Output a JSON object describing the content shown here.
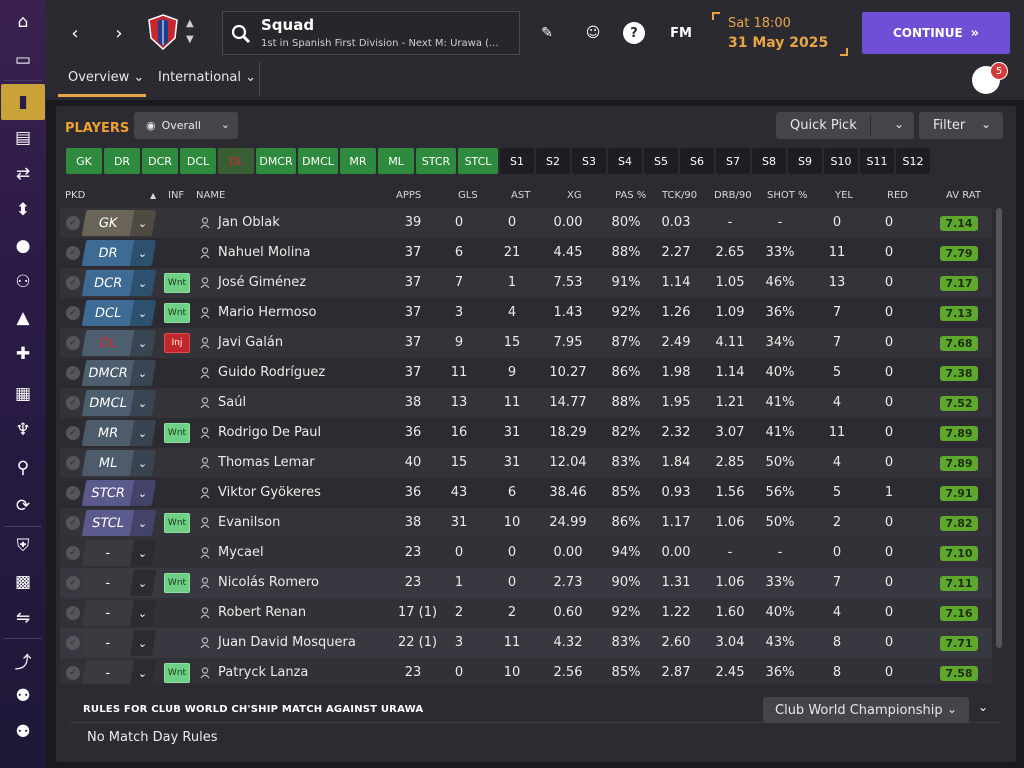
{
  "header": {
    "title": "Squad",
    "subtitle": "1st in Spanish First Division - Next M: Urawa (...",
    "date_time": "Sat 18:00",
    "date_day": "31 May 2025",
    "continue_label": "CONTINUE",
    "tabs": [
      {
        "label": "Overview",
        "active": true
      },
      {
        "label": "International",
        "active": false
      }
    ],
    "notification_count": "5",
    "fm_label": "FM",
    "help_label": "?"
  },
  "toolbar": {
    "players_label": "PLAYERS",
    "view_label": "Overall",
    "quick_pick_label": "Quick Pick",
    "filter_label": "Filter"
  },
  "position_filters": [
    "GK",
    "DR",
    "DCR",
    "DCL",
    "DL",
    "DMCR",
    "DMCL",
    "MR",
    "ML",
    "STCR",
    "STCL",
    "S1",
    "S2",
    "S3",
    "S4",
    "S5",
    "S6",
    "S7",
    "S8",
    "S9",
    "S10",
    "S11",
    "S12"
  ],
  "columns": [
    "PKD",
    "INF",
    "NAME",
    "APPS",
    "GLS",
    "AST",
    "XG",
    "PAS %",
    "TCK/90",
    "DRB/90",
    "SHOT %",
    "YEL",
    "RED",
    "AV RAT"
  ],
  "players": [
    {
      "pos": "GK",
      "inf": "",
      "name": "Jan Oblak",
      "apps": "39",
      "gls": "0",
      "ast": "0",
      "xg": "0.00",
      "pas": "80%",
      "tck": "0.03",
      "drb": "-",
      "shot": "-",
      "yel": "0",
      "red": "0",
      "rat": "7.14"
    },
    {
      "pos": "DR",
      "inf": "",
      "name": "Nahuel Molina",
      "apps": "37",
      "gls": "6",
      "ast": "21",
      "xg": "4.45",
      "pas": "88%",
      "tck": "2.27",
      "drb": "2.65",
      "shot": "33%",
      "yel": "11",
      "red": "0",
      "rat": "7.79"
    },
    {
      "pos": "DCR",
      "inf": "Wnt",
      "name": "José Giménez",
      "apps": "37",
      "gls": "7",
      "ast": "1",
      "xg": "7.53",
      "pas": "91%",
      "tck": "1.14",
      "drb": "1.05",
      "shot": "46%",
      "yel": "13",
      "red": "0",
      "rat": "7.17"
    },
    {
      "pos": "DCL",
      "inf": "Wnt",
      "name": "Mario Hermoso",
      "apps": "37",
      "gls": "3",
      "ast": "4",
      "xg": "1.43",
      "pas": "92%",
      "tck": "1.26",
      "drb": "1.09",
      "shot": "36%",
      "yel": "7",
      "red": "0",
      "rat": "7.13"
    },
    {
      "pos": "DL",
      "inf": "Inj",
      "name": "Javi Galán",
      "apps": "37",
      "gls": "9",
      "ast": "15",
      "xg": "7.95",
      "pas": "87%",
      "tck": "2.49",
      "drb": "4.11",
      "shot": "34%",
      "yel": "7",
      "red": "0",
      "rat": "7.68"
    },
    {
      "pos": "DMCR",
      "inf": "",
      "name": "Guido Rodríguez",
      "apps": "37",
      "gls": "11",
      "ast": "9",
      "xg": "10.27",
      "pas": "86%",
      "tck": "1.98",
      "drb": "1.14",
      "shot": "40%",
      "yel": "5",
      "red": "0",
      "rat": "7.38"
    },
    {
      "pos": "DMCL",
      "inf": "",
      "name": "Saúl",
      "apps": "38",
      "gls": "13",
      "ast": "11",
      "xg": "14.77",
      "pas": "88%",
      "tck": "1.95",
      "drb": "1.21",
      "shot": "41%",
      "yel": "4",
      "red": "0",
      "rat": "7.52"
    },
    {
      "pos": "MR",
      "inf": "Wnt",
      "name": "Rodrigo De Paul",
      "apps": "36",
      "gls": "16",
      "ast": "31",
      "xg": "18.29",
      "pas": "82%",
      "tck": "2.32",
      "drb": "3.07",
      "shot": "41%",
      "yel": "11",
      "red": "0",
      "rat": "7.89"
    },
    {
      "pos": "ML",
      "inf": "",
      "name": "Thomas Lemar",
      "apps": "40",
      "gls": "15",
      "ast": "31",
      "xg": "12.04",
      "pas": "83%",
      "tck": "1.84",
      "drb": "2.85",
      "shot": "50%",
      "yel": "4",
      "red": "0",
      "rat": "7.89"
    },
    {
      "pos": "STCR",
      "inf": "",
      "name": "Viktor Gyökeres",
      "apps": "36",
      "gls": "43",
      "ast": "6",
      "xg": "38.46",
      "pas": "85%",
      "tck": "0.93",
      "drb": "1.56",
      "shot": "56%",
      "yel": "5",
      "red": "1",
      "rat": "7.91"
    },
    {
      "pos": "STCL",
      "inf": "Wnt",
      "name": "Evanilson",
      "apps": "38",
      "gls": "31",
      "ast": "10",
      "xg": "24.99",
      "pas": "86%",
      "tck": "1.17",
      "drb": "1.06",
      "shot": "50%",
      "yel": "2",
      "red": "0",
      "rat": "7.82"
    },
    {
      "pos": "-",
      "inf": "",
      "name": "Mycael",
      "apps": "23",
      "gls": "0",
      "ast": "0",
      "xg": "0.00",
      "pas": "94%",
      "tck": "0.00",
      "drb": "-",
      "shot": "-",
      "yel": "0",
      "red": "0",
      "rat": "7.10"
    },
    {
      "pos": "-",
      "inf": "Wnt",
      "name": "Nicolás Romero",
      "apps": "23",
      "gls": "1",
      "ast": "0",
      "xg": "2.73",
      "pas": "90%",
      "tck": "1.31",
      "drb": "1.06",
      "shot": "33%",
      "yel": "7",
      "red": "0",
      "rat": "7.11"
    },
    {
      "pos": "-",
      "inf": "",
      "name": "Robert Renan",
      "apps": "17 (1)",
      "gls": "2",
      "ast": "2",
      "xg": "0.60",
      "pas": "92%",
      "tck": "1.22",
      "drb": "1.60",
      "shot": "40%",
      "yel": "4",
      "red": "0",
      "rat": "7.16"
    },
    {
      "pos": "-",
      "inf": "",
      "name": "Juan David Mosquera",
      "apps": "22 (1)",
      "gls": "3",
      "ast": "11",
      "xg": "4.32",
      "pas": "83%",
      "tck": "2.60",
      "drb": "3.04",
      "shot": "43%",
      "yel": "8",
      "red": "0",
      "rat": "7.71"
    },
    {
      "pos": "-",
      "inf": "Wnt",
      "name": "Patryck Lanza",
      "apps": "23",
      "gls": "0",
      "ast": "10",
      "xg": "2.56",
      "pas": "85%",
      "tck": "2.87",
      "drb": "2.45",
      "shot": "36%",
      "yel": "8",
      "red": "0",
      "rat": "7.58"
    }
  ],
  "rules": {
    "title": "RULES FOR CLUB WORLD CH'SHIP MATCH AGAINST URAWA",
    "text": "No Match Day Rules",
    "competition": "Club World Championship"
  },
  "colors": {
    "accent_orange": "#e8a545",
    "continue_purple": "#6f4fd6",
    "rating_green": "#5fa82e",
    "filter_green": "#2e8b3e"
  },
  "sidebar_icons": [
    "home-icon",
    "inbox-icon",
    "squad-icon",
    "tactics-icon",
    "transfers-icon",
    "training-icon",
    "scouting-icon",
    "staff-icon",
    "club-vision-icon",
    "medical-icon",
    "schedule-icon",
    "competitions-icon",
    "search-icon",
    "refresh-icon",
    "club-icon",
    "finances-icon",
    "transfer-negotiations-icon",
    "development-icon",
    "u19-icon",
    "b-team-icon"
  ]
}
